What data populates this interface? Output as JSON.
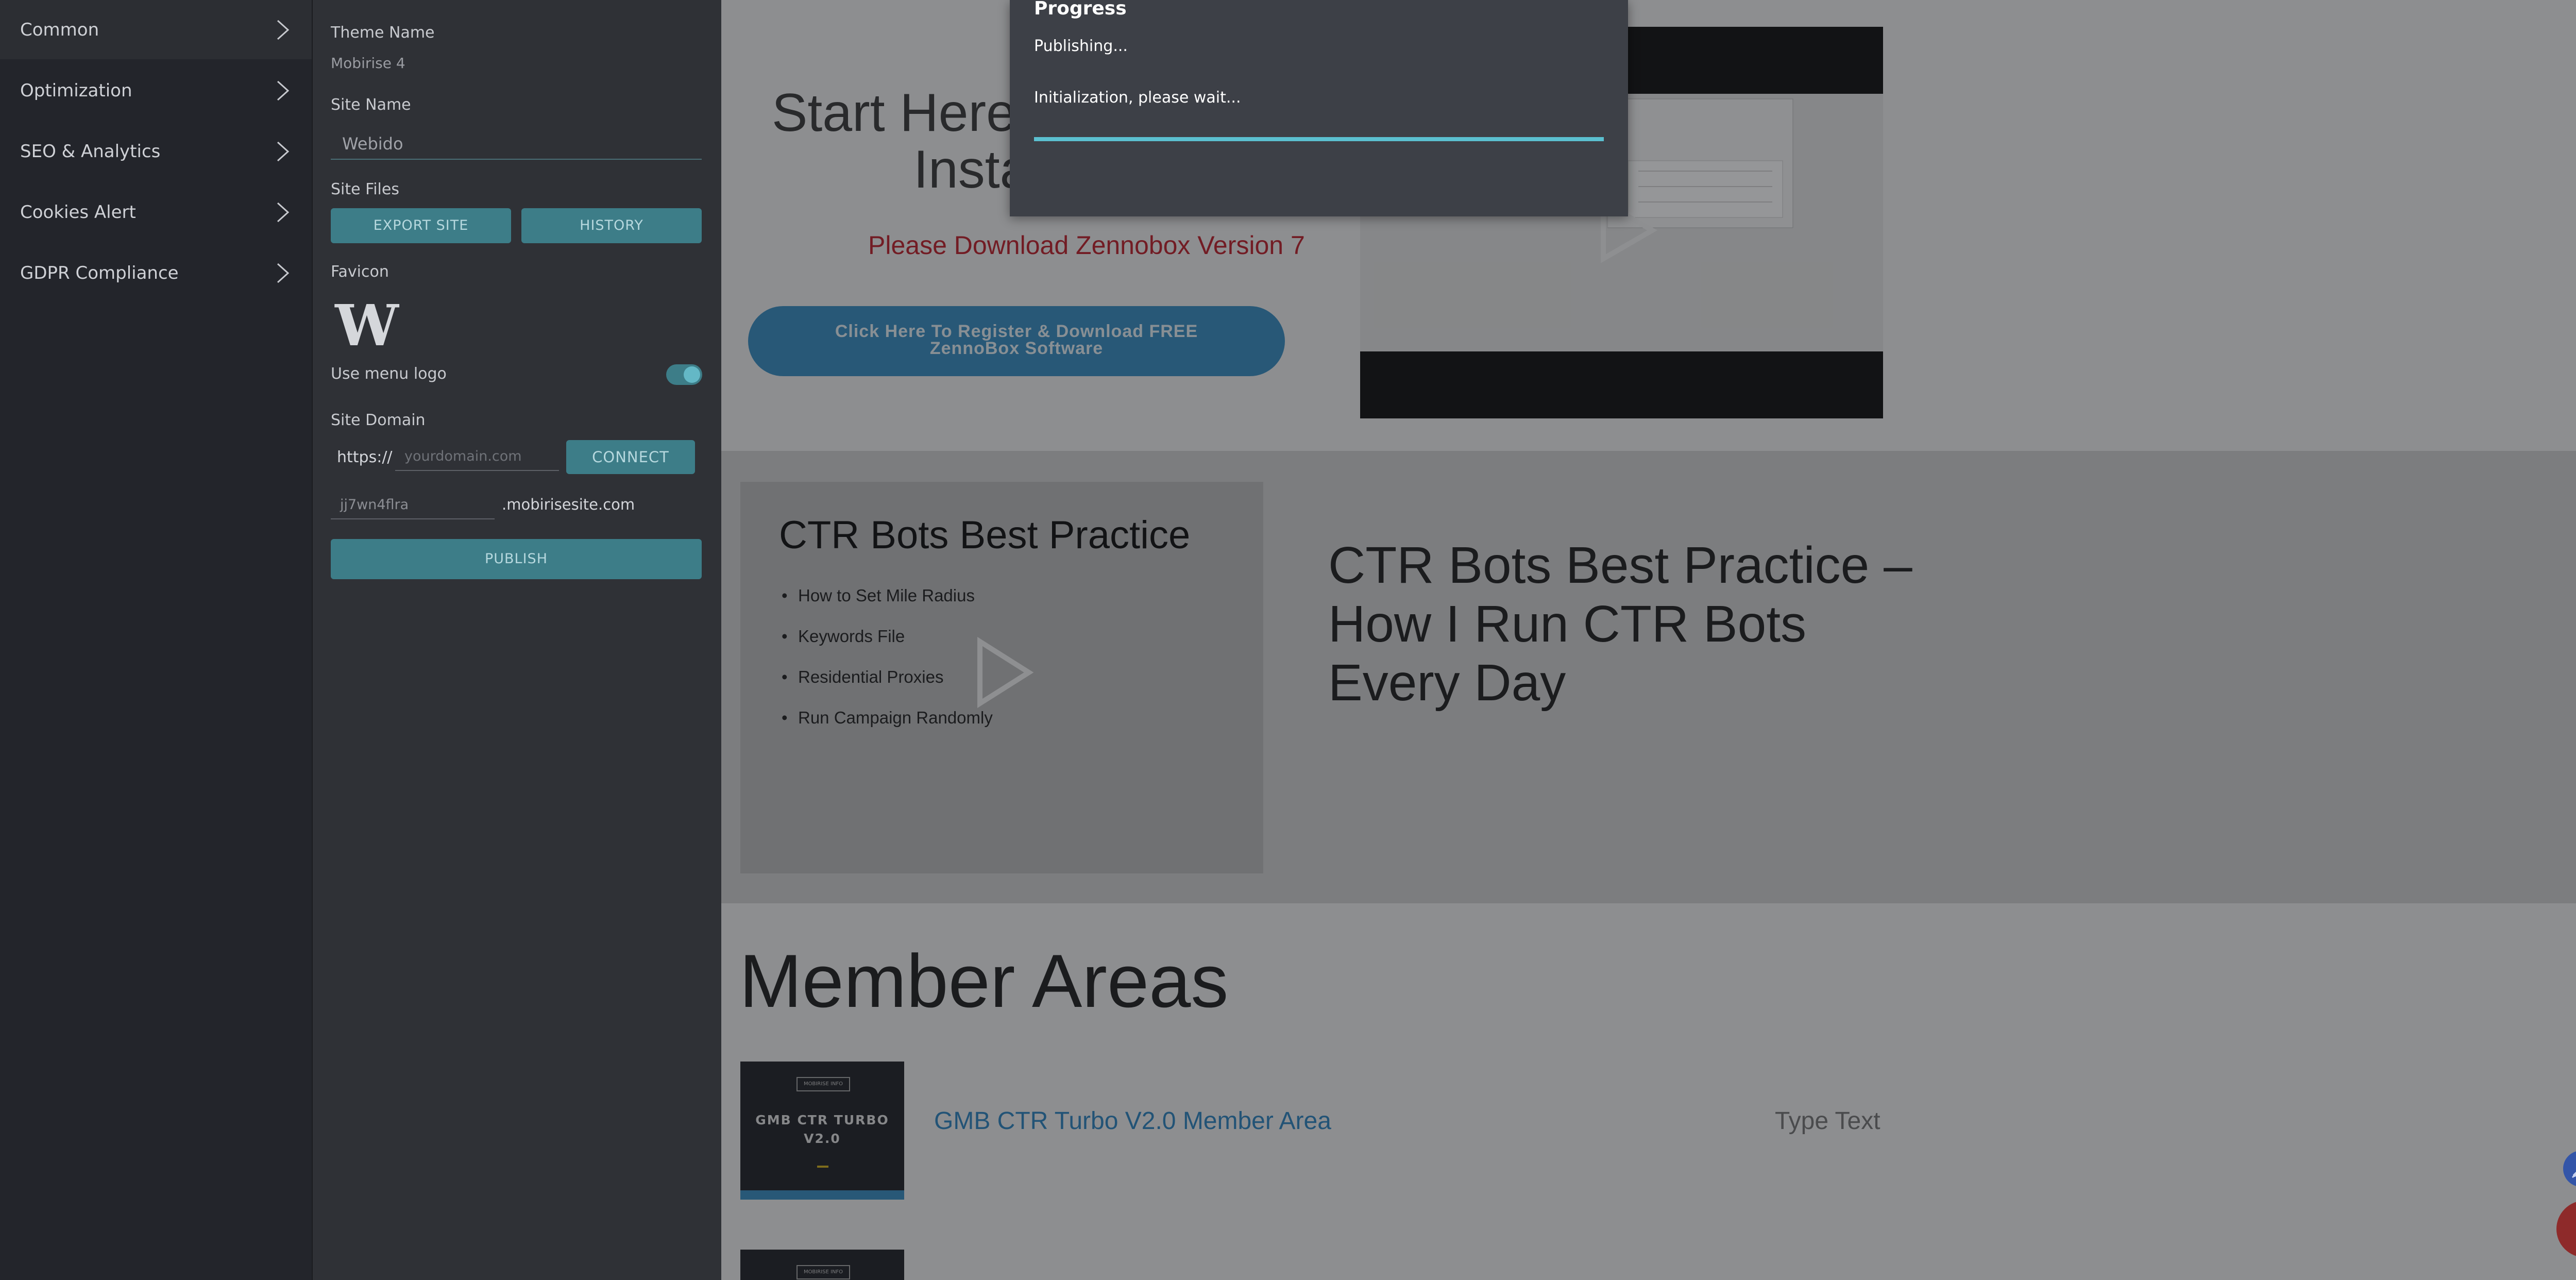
{
  "nav": {
    "items": [
      {
        "label": "Common",
        "active": true
      },
      {
        "label": "Optimization",
        "active": false
      },
      {
        "label": "SEO & Analytics",
        "active": false
      },
      {
        "label": "Cookies Alert",
        "active": false
      },
      {
        "label": "GDPR Compliance",
        "active": false
      }
    ]
  },
  "settings": {
    "theme_name_label": "Theme Name",
    "theme_name_value": "Mobirise 4",
    "site_name_label": "Site Name",
    "site_name_value": "Webido",
    "site_files_label": "Site Files",
    "export_site_label": "EXPORT SITE",
    "history_label": "HISTORY",
    "favicon_label": "Favicon",
    "favicon_letter": "W",
    "use_menu_logo_label": "Use menu logo",
    "use_menu_logo_on": true,
    "site_domain_label": "Site Domain",
    "protocol": "https://",
    "domain_placeholder": "yourdomain.com",
    "connect_label": "CONNECT",
    "subdomain_value": "jj7wn4flra",
    "subdomain_suffix": ".mobirisesite.com",
    "publish_label": "PUBLISH"
  },
  "preview": {
    "hero_line1": "Start Here:",
    "hero_line2": "Insta",
    "download_notice": "Please Download Zennobox Version 7",
    "register_line1": "Click Here To Register & Download FREE",
    "register_line2": "ZennoBox Software",
    "slide_title": "CTR Bots Best Practice",
    "slide_bullets": [
      "How to Set Mile Radius",
      "Keywords File",
      "Residential Proxies",
      "Run Campaign Randomly"
    ],
    "ctr_heading_lines": [
      "CTR Bots Best Practice –",
      "How I Run CTR Bots",
      "Every Day"
    ],
    "member_areas_title": "Member Areas",
    "thumb_tag": "MOBIRISE INFO",
    "thumb_title_line1": "GMB CTR TURBO",
    "thumb_title_line2": "V2.0",
    "member_link": "GMB CTR Turbo V2.0 Member Area",
    "type_text": "Type Text"
  },
  "progress": {
    "title": "Progress",
    "status": "Publishing...",
    "detail": "Initialization, please wait...",
    "fraction": 1.0
  },
  "colors": {
    "accent": "#3d7d88",
    "progress": "#5bc0d0",
    "link": "#2f86c2",
    "notice_red": "#c0212c"
  },
  "icons": [
    "chevron-right-icon",
    "play-icon",
    "pencil-icon",
    "plus-icon"
  ]
}
